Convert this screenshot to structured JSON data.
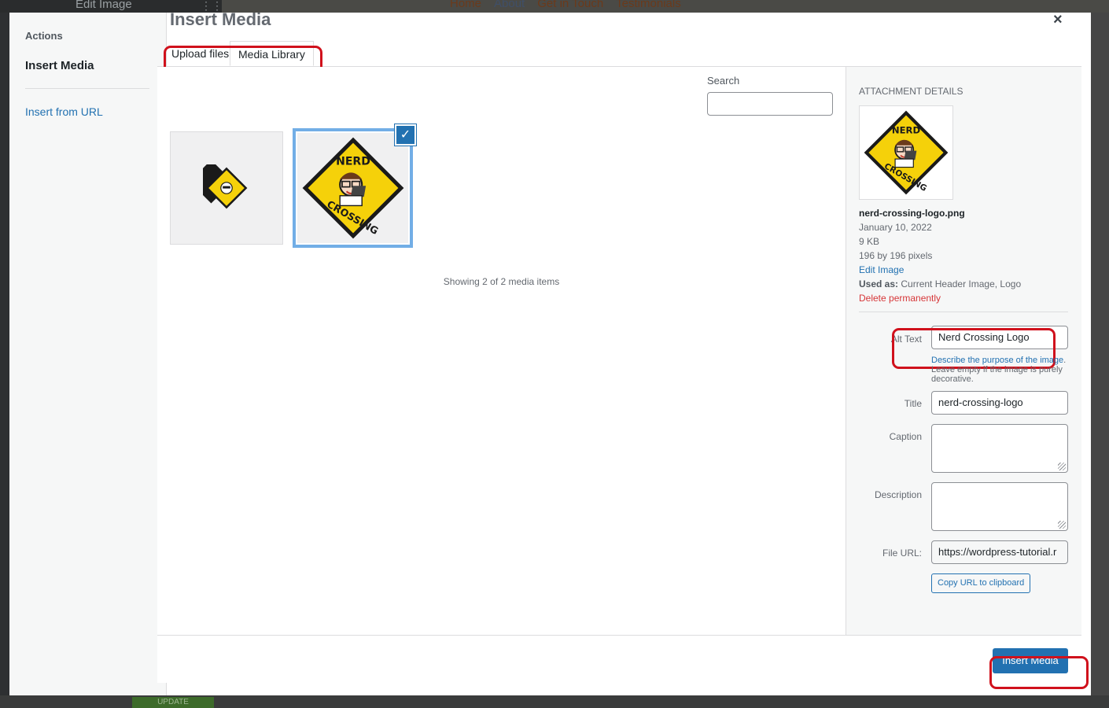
{
  "background": {
    "edit_title": "Edit Image",
    "nav": [
      "Home",
      "About",
      "Get in Touch",
      "Testimonials"
    ],
    "update_label": "UPDATE"
  },
  "menu": {
    "actions_label": "Actions",
    "insert_media": "Insert Media",
    "insert_from_url": "Insert from URL"
  },
  "modal": {
    "title": "Insert Media",
    "close_label": "×"
  },
  "tabs": {
    "upload": "Upload files",
    "library": "Media Library"
  },
  "search": {
    "label": "Search",
    "value": ""
  },
  "library": {
    "selected_check": "✓",
    "showing_text": "Showing 2 of 2 media items"
  },
  "attachment": {
    "section_title": "Attachment Details",
    "filename": "nerd-crossing-logo.png",
    "date": "January 10, 2022",
    "size": "9 KB",
    "dimensions": "196 by 196 pixels",
    "edit_link": "Edit Image",
    "used_as_label": "Used as:",
    "used_as_value": "Current Header Image, Logo",
    "delete_link": "Delete permanently"
  },
  "fields": {
    "alt_label": "Alt Text",
    "alt_value": "Nerd Crossing Logo",
    "alt_desc_link": "Describe the purpose of the image",
    "alt_desc_rest": ". Leave empty if the image is purely decorative.",
    "title_label": "Title",
    "title_value": "nerd-crossing-logo",
    "caption_label": "Caption",
    "description_label": "Description",
    "file_url_label": "File URL:",
    "file_url_value": "https://wordpress-tutorial.r",
    "copy_url": "Copy URL to clipboard"
  },
  "footer": {
    "insert_button": "Insert Media"
  },
  "logo": {
    "line1": "NERD",
    "line2": "CROSSING"
  },
  "colors": {
    "accent": "#2271b1",
    "annotation_red": "#d0111c",
    "logo_yellow": "#f5d10a"
  }
}
